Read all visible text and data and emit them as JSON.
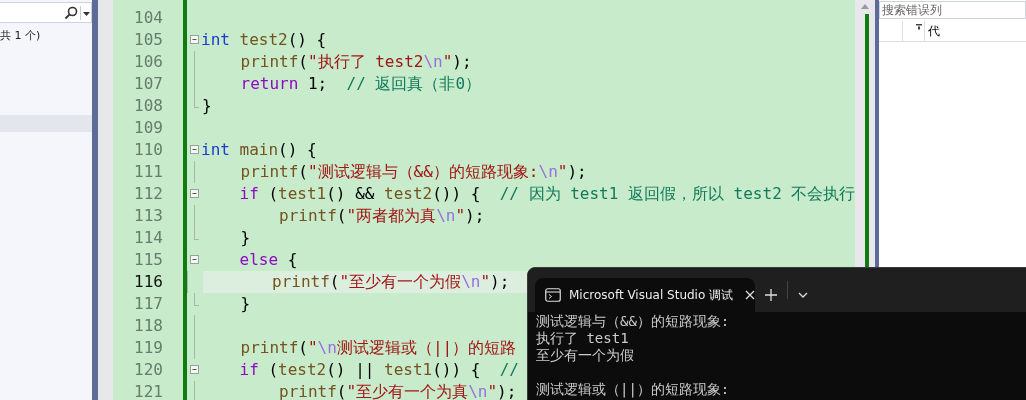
{
  "left_panel": {
    "status_text": "共 1 个)",
    "list_rows": [
      {
        "selected": true
      }
    ]
  },
  "editor": {
    "lines": [
      {
        "number": "104",
        "current": false,
        "kind": "plain"
      },
      {
        "number": "105",
        "current": false,
        "kind": "fold_start",
        "tokens": [
          {
            "kind": "keyword",
            "text": "int "
          },
          {
            "kind": "function",
            "text": "test2"
          },
          {
            "kind": "plain",
            "text": "() {"
          }
        ]
      },
      {
        "number": "106",
        "current": false,
        "kind": "fold_body",
        "tokens": [
          {
            "kind": "function",
            "text": "    printf"
          },
          {
            "kind": "plain",
            "text": "("
          },
          {
            "kind": "string",
            "text": "\"执行了 test2"
          },
          {
            "kind": "escape",
            "text": "\\n"
          },
          {
            "kind": "string",
            "text": "\""
          },
          {
            "kind": "plain",
            "text": ");"
          }
        ]
      },
      {
        "number": "107",
        "current": false,
        "kind": "fold_body",
        "tokens": [
          {
            "kind": "control",
            "text": "    return"
          },
          {
            "kind": "plain",
            "text": " 1;"
          },
          {
            "kind": "comment",
            "text": "  // 返回真（非0）"
          }
        ]
      },
      {
        "number": "108",
        "current": false,
        "kind": "fold_end",
        "tokens": [
          {
            "kind": "plain",
            "text": "}"
          }
        ]
      },
      {
        "number": "109",
        "current": false,
        "kind": "plain"
      },
      {
        "number": "110",
        "current": false,
        "kind": "fold_start",
        "tokens": [
          {
            "kind": "keyword",
            "text": "int "
          },
          {
            "kind": "function",
            "text": "main"
          },
          {
            "kind": "plain",
            "text": "() {"
          }
        ]
      },
      {
        "number": "111",
        "current": false,
        "kind": "fold_body",
        "tokens": [
          {
            "kind": "function",
            "text": "    printf"
          },
          {
            "kind": "plain",
            "text": "("
          },
          {
            "kind": "string",
            "text": "\"测试逻辑与（&&）的短路现象:"
          },
          {
            "kind": "escape",
            "text": "\\n"
          },
          {
            "kind": "string",
            "text": "\""
          },
          {
            "kind": "plain",
            "text": ");"
          }
        ]
      },
      {
        "number": "112",
        "current": false,
        "kind": "fold_start",
        "tokens": [
          {
            "kind": "control",
            "text": "    if"
          },
          {
            "kind": "plain",
            "text": " ("
          },
          {
            "kind": "function",
            "text": "test1"
          },
          {
            "kind": "plain",
            "text": "() && "
          },
          {
            "kind": "function",
            "text": "test2"
          },
          {
            "kind": "plain",
            "text": "()) {"
          },
          {
            "kind": "comment",
            "text": "  // 因为 test1 返回假，所以 test2 不会执行"
          }
        ]
      },
      {
        "number": "113",
        "current": false,
        "kind": "fold_body",
        "tokens": [
          {
            "kind": "function",
            "text": "        printf"
          },
          {
            "kind": "plain",
            "text": "("
          },
          {
            "kind": "string",
            "text": "\"两者都为真"
          },
          {
            "kind": "escape",
            "text": "\\n"
          },
          {
            "kind": "string",
            "text": "\""
          },
          {
            "kind": "plain",
            "text": ");"
          }
        ]
      },
      {
        "number": "114",
        "current": false,
        "kind": "fold_end",
        "tokens": [
          {
            "kind": "plain",
            "text": "    }"
          }
        ]
      },
      {
        "number": "115",
        "current": false,
        "kind": "fold_start",
        "tokens": [
          {
            "kind": "control",
            "text": "    else"
          },
          {
            "kind": "plain",
            "text": " {"
          }
        ]
      },
      {
        "number": "116",
        "current": true,
        "kind": "fold_body",
        "tokens": [
          {
            "kind": "function",
            "text": "        printf"
          },
          {
            "kind": "plain",
            "text": "("
          },
          {
            "kind": "string",
            "text": "\"至少有一个为假"
          },
          {
            "kind": "escape",
            "text": "\\n"
          },
          {
            "kind": "string",
            "text": "\""
          },
          {
            "kind": "plain",
            "text": ");"
          }
        ]
      },
      {
        "number": "117",
        "current": false,
        "kind": "fold_end",
        "tokens": [
          {
            "kind": "plain",
            "text": "    }"
          }
        ]
      },
      {
        "number": "118",
        "current": false,
        "kind": "fold_body"
      },
      {
        "number": "119",
        "current": false,
        "kind": "fold_body",
        "tokens": [
          {
            "kind": "function",
            "text": "    printf"
          },
          {
            "kind": "plain",
            "text": "("
          },
          {
            "kind": "string",
            "text": "\""
          },
          {
            "kind": "escape",
            "text": "\\n"
          },
          {
            "kind": "string",
            "text": "测试逻辑或（||）的短路"
          }
        ]
      },
      {
        "number": "120",
        "current": false,
        "kind": "fold_start",
        "tokens": [
          {
            "kind": "control",
            "text": "    if"
          },
          {
            "kind": "plain",
            "text": " ("
          },
          {
            "kind": "function",
            "text": "test2"
          },
          {
            "kind": "plain",
            "text": "() || "
          },
          {
            "kind": "function",
            "text": "test1"
          },
          {
            "kind": "plain",
            "text": "()) {"
          },
          {
            "kind": "comment",
            "text": "  //"
          }
        ]
      },
      {
        "number": "121",
        "current": false,
        "kind": "fold_body",
        "tokens": [
          {
            "kind": "function",
            "text": "        printf"
          },
          {
            "kind": "plain",
            "text": "("
          },
          {
            "kind": "string",
            "text": "\"至少有一个为真"
          },
          {
            "kind": "escape",
            "text": "\\n"
          },
          {
            "kind": "string",
            "text": "\""
          },
          {
            "kind": "plain",
            "text": ");"
          }
        ]
      }
    ]
  },
  "error_list": {
    "search": {
      "placeholder": "搜索错误列"
    },
    "header": {
      "column_3": "代"
    }
  },
  "terminal": {
    "tab": {
      "title": "Microsoft Visual Studio 调试",
      "selected": true
    },
    "output": [
      [
        "测试逻辑与（&&）的短路现象:",
        "执行了 test1",
        "至少有一个为假"
      ],
      [
        "测试逻辑或（||）的短路现象:"
      ]
    ]
  }
}
